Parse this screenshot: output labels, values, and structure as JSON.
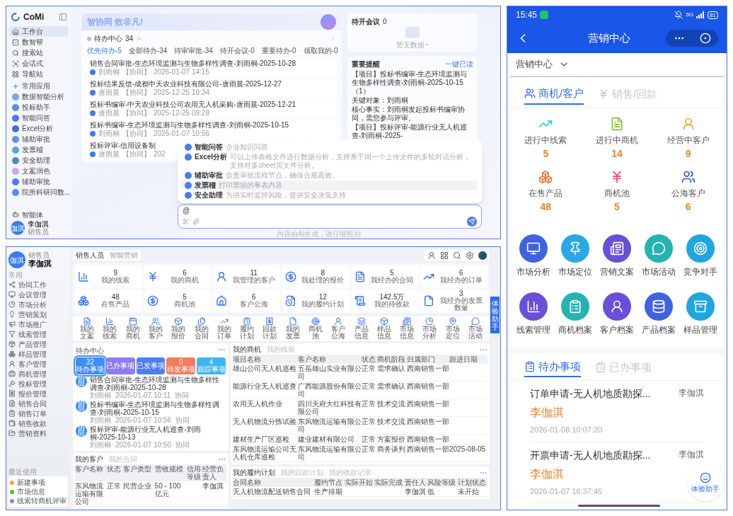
{
  "assistant": {
    "logo": "CoMi",
    "nav": [
      {
        "label": "工作台",
        "selected": true
      },
      {
        "label": "数智帮",
        "selected": false
      },
      {
        "label": "搜索站",
        "selected": false
      },
      {
        "label": "会话式",
        "selected": false
      },
      {
        "label": "导航站",
        "selected": false
      }
    ],
    "apps_header": "常用应用",
    "apps": [
      "数据智能分析",
      "投标助手",
      "智能问答",
      "Excel分析",
      "辅助审批",
      "发票稽",
      "安全助理",
      "文案润色",
      "辅助审批",
      "院所科研问数..."
    ],
    "agents_link": "智能体",
    "user": {
      "avatar": "伽淇",
      "name": "李伽淇",
      "role": "销售员"
    },
    "banner": "智协同 效非凡!",
    "todo": {
      "title": "待办中心",
      "count": "34",
      "tabs": [
        {
          "label": "优先待办-5",
          "selected": true
        },
        {
          "label": "全部待办-34",
          "selected": false
        },
        {
          "label": "待审审批-34",
          "selected": false
        },
        {
          "label": "待开会议-0",
          "selected": false
        },
        {
          "label": "重要待办-0",
          "selected": false
        },
        {
          "label": "领取我的-0",
          "selected": false
        }
      ],
      "items": [
        {
          "title": "销售合同审批-生态环境监测与生物多样性调查-刘雨桐-2025-10-28",
          "author": "刘雨桐",
          "tag": "【协同】",
          "time": "2026-01-07 14:15"
        },
        {
          "title": "投标结果反馈-成都中天农业科技有限公司-唐雨晨-2025-12-27",
          "author": "唐雨晨",
          "tag": "【协同】",
          "time": "2025-12-25 10:34"
        },
        {
          "title": "投标书编审-中天农业科技公司农用无人机采购-唐雨晨-2025-12-21",
          "author": "唐雨晨",
          "tag": "【协同】",
          "time": "2025-12-25 09:28"
        },
        {
          "title": "投标书编审-生态环境监测与生物多样性调查-刘雨桐-2025-10-15",
          "author": "刘雨桐",
          "tag": "【协同】",
          "time": "2026-01-07 10:56"
        },
        {
          "title": "投标评审-信用设备制",
          "author": "唐雨晨",
          "tag": "【协同】",
          "time": "202"
        }
      ]
    },
    "meetings": {
      "title": "待开会议",
      "count": "0",
      "empty": "暂无数据~"
    },
    "reminders": {
      "title": "重要提醒",
      "action": "一键已读",
      "paragraphs": [
        "【项目】投标书编审-生态环境监测与生物多样性调查-刘雨桐-2025-10-15（1）",
        "关键对象：刘雨桐",
        "核心事实：刘雨桐发起投标书编审协同，需您参与评审。",
        "【项目】投标评审-能源行业无人机巡查-刘雨桐-2025-"
      ]
    },
    "agent_menu": [
      {
        "name": "智能问答",
        "desc": "企业知识问答",
        "selected": false
      },
      {
        "name": "Excel分析",
        "desc": "可以上传表格文件进行数据分析，支持基于同一个上传文件的多轮对话分析，支持对多sheet页文件分析。",
        "selected": false
      },
      {
        "name": "辅助审批",
        "desc": "负责审批流程节点，确保合规高效。",
        "selected": false
      },
      {
        "name": "发票稽",
        "desc": "打印票据的事表内容",
        "selected": true
      },
      {
        "name": "安全助理",
        "desc": "为供实时监控风险，提供安全决策支持",
        "selected": false
      }
    ],
    "composer": {
      "value": "@"
    },
    "footer": "内容由AI生成，请仔细甄别"
  },
  "crm": {
    "user": {
      "avatar": "伽淇",
      "role": "销售员",
      "name": "李伽淇"
    },
    "menu_header": "常用",
    "menu": [
      "协同工作",
      "会议管理",
      "市场分析",
      "营销策划",
      "市场推广",
      "线索管理",
      "产品管理",
      "样品管理",
      "客户管理",
      "商机管理",
      "投标管理",
      "报价管理",
      "销售合同",
      "销售订单",
      "销售收款",
      "营销资料"
    ],
    "recent_header": "最近使用",
    "recent": [
      {
        "label": "新建事项",
        "color": "#f5a623"
      },
      {
        "label": "市场信息",
        "color": "#52c41a"
      },
      {
        "label": "线索转商机评审",
        "color": "#8c7ef0"
      }
    ],
    "tabs": [
      {
        "label": "销售人员",
        "selected": true
      },
      {
        "label": "智能营销",
        "selected": false
      }
    ],
    "stats": [
      {
        "value": "9",
        "label": "我的线索"
      },
      {
        "value": "6",
        "label": "我的商机"
      },
      {
        "value": "11",
        "label": "我管理的客户"
      },
      {
        "value": "8",
        "label": "我处理的报价"
      },
      {
        "value": "5",
        "label": "我经办的合同"
      },
      {
        "value": "6",
        "label": "我经办的订单"
      },
      {
        "value": "48",
        "label": "在售产品"
      },
      {
        "value": "5",
        "label": "商机池"
      },
      {
        "value": "6",
        "label": "客户公海"
      },
      {
        "value": "12",
        "label": "我的履约计划"
      },
      {
        "value": "142.5万",
        "label": "我的待收款"
      },
      {
        "value": "3",
        "label": "我经办的发票数量"
      }
    ],
    "shortcuts": [
      "我的文案",
      "我的线索",
      "我的商机",
      "我的客户",
      "我的报价",
      "我的合同",
      "我的订单",
      "履约计划",
      "回款计划",
      "我的发票",
      "商机池",
      "客户公海",
      "产品信息",
      "样品信息",
      "市场信息",
      "市场分析",
      "市场定位",
      "市场活动"
    ],
    "todo": {
      "title": "待办中心",
      "tiles": [
        {
          "value": "32",
          "label": "待办事项",
          "color": "#3d8ef0",
          "selected": true
        },
        {
          "label": "已办事项",
          "color": "#8c7ef0",
          "selected": false
        },
        {
          "label": "已发事项",
          "color": "#4f7df5",
          "selected": false
        },
        {
          "value": "0",
          "label": "待发事项",
          "color": "#f47b5c",
          "selected": false
        },
        {
          "value": "4",
          "label": "跟踪事项",
          "color": "#3fb4f5",
          "selected": false
        }
      ],
      "items": [
        {
          "badge": "协同",
          "title": "销售合同审批-生态环境监测与生物多样性调查-刘雨桐-2025-10-28",
          "author": "刘雨桐",
          "time": "2026-01-07 10:11",
          "tag": "协同"
        },
        {
          "badge": "协同",
          "title": "投标书编审-生态环境监测与生物多样性调查-刘雨桐-2025-10-15",
          "author": "刘雨桐",
          "time": "2026-01-07 10:56",
          "tag": "协同"
        },
        {
          "badge": "协同",
          "title": "投标评审-能源行业无人机巡查-刘雨桐-2025-10-13",
          "author": "刘雨桐",
          "time": "2026-01-07 10:50",
          "tag": "协同"
        }
      ]
    },
    "opportunities": {
      "tabs": [
        {
          "label": "我的商机",
          "selected": true
        },
        {
          "label": "我的线索",
          "selected": false
        }
      ],
      "columns": [
        "项目名称",
        "客户名称",
        "状态",
        "商机阶段",
        "归属部门",
        "跟进日期"
      ],
      "rows": [
        [
          "雄山公司无人机巡检",
          "五岳雄山实业有限公司",
          "正常",
          "需求确认",
          "西南销售一部",
          ""
        ],
        [
          "能源行业无人机巡查",
          "广西能源股份有限公司",
          "正常",
          "需求确认",
          "西南销售一部",
          ""
        ],
        [
          "农用无人机作业",
          "四川天府大红科技有限公司",
          "正常",
          "技术交流",
          "西南销售一部",
          ""
        ],
        [
          "无人机物流分拣试验",
          "东风物流运输有限公司",
          "正常",
          "技术交流",
          "西南销售一部",
          ""
        ],
        [
          "建材生产厂区巡检",
          "建业建材有限公司",
          "正常",
          "方案报价",
          "西南销售一部",
          ""
        ],
        [
          "东风物流运输公司无人机仓库巡检",
          "东风物流运输有限公司",
          "正常",
          "商务谈判",
          "西南销售一部",
          "2025-08-05"
        ]
      ]
    },
    "customers": {
      "tabs": [
        {
          "label": "我的客户",
          "selected": true
        },
        {
          "label": "我的合同",
          "selected": false
        }
      ],
      "columns": [
        "客户名称",
        "状态",
        "客户类型",
        "营收规模",
        "信用等级",
        "经营负责人"
      ],
      "rows": [
        [
          "东风物流运输有限公司",
          "正常",
          "民营企业",
          "50 - 100亿元",
          "",
          "李伽淇"
        ]
      ]
    },
    "plans": {
      "tabs": [
        {
          "label": "我的履约计划",
          "selected": true
        },
        {
          "label": "我的回款计划",
          "selected": false
        },
        {
          "label": "我的收款记录",
          "selected": false
        }
      ],
      "columns": [
        "合同名称",
        "履约节点",
        "实际开始",
        "实际完成",
        "责任人",
        "风险等级",
        "计划状态"
      ],
      "rows": [
        [
          "无人机物流配送销售合同",
          "生产排期",
          "",
          "",
          "李伽淇",
          "低",
          "未开始"
        ]
      ]
    },
    "assistant_tab": "体验助手"
  },
  "mobile": {
    "time": "15:45",
    "network": "5G",
    "battery": "81",
    "title": "营销中心",
    "selector": "营销中心",
    "tabs": [
      {
        "label": "商机/客户",
        "selected": true
      },
      {
        "label": "销售/回款",
        "selected": false
      }
    ],
    "stats": [
      {
        "label": "进行中线索",
        "value": "5",
        "color": "#3cc6e0"
      },
      {
        "label": "进行中商机",
        "value": "14",
        "color": "#7dc63b"
      },
      {
        "label": "经营中客户",
        "value": "9",
        "color": "#f5a623"
      },
      {
        "label": "在售产品",
        "value": "48",
        "color": "#f07a3a"
      },
      {
        "label": "商机池",
        "value": "5",
        "color": "#e84c5a"
      },
      {
        "label": "公海客户",
        "value": "6",
        "color": "#2f54c8"
      }
    ],
    "apps": [
      {
        "label": "市场分析",
        "color": "#3f63e0"
      },
      {
        "label": "市场定位",
        "color": "#29a8e6"
      },
      {
        "label": "营销文案",
        "color": "#6a4fd8"
      },
      {
        "label": "市场活动",
        "color": "#25b3b0"
      },
      {
        "label": "竞争对手",
        "color": "#1fa5e0"
      },
      {
        "label": "线索管理",
        "color": "#6a4fd8"
      },
      {
        "label": "商机档案",
        "color": "#25b3b0"
      },
      {
        "label": "客户档案",
        "color": "#6a4fd8"
      },
      {
        "label": "产品档案",
        "color": "#3f63e0"
      },
      {
        "label": "样品管理",
        "color": "#1fa5e0"
      }
    ],
    "task_tabs": [
      {
        "label": "待办事项",
        "selected": true
      },
      {
        "label": "已办事项",
        "selected": false
      }
    ],
    "tasks": [
      {
        "title": "订单申请-无人机地质勘探...",
        "owner": "李伽淇",
        "applicant": "李伽淇",
        "time": "2026-01-08 10:07:20"
      },
      {
        "title": "开票申请-无人机地质勘探...",
        "owner": "李伽淇",
        "applicant": "李伽淇",
        "time": "2026-01-07 16:37:45"
      }
    ],
    "assistant": "体验助手"
  }
}
